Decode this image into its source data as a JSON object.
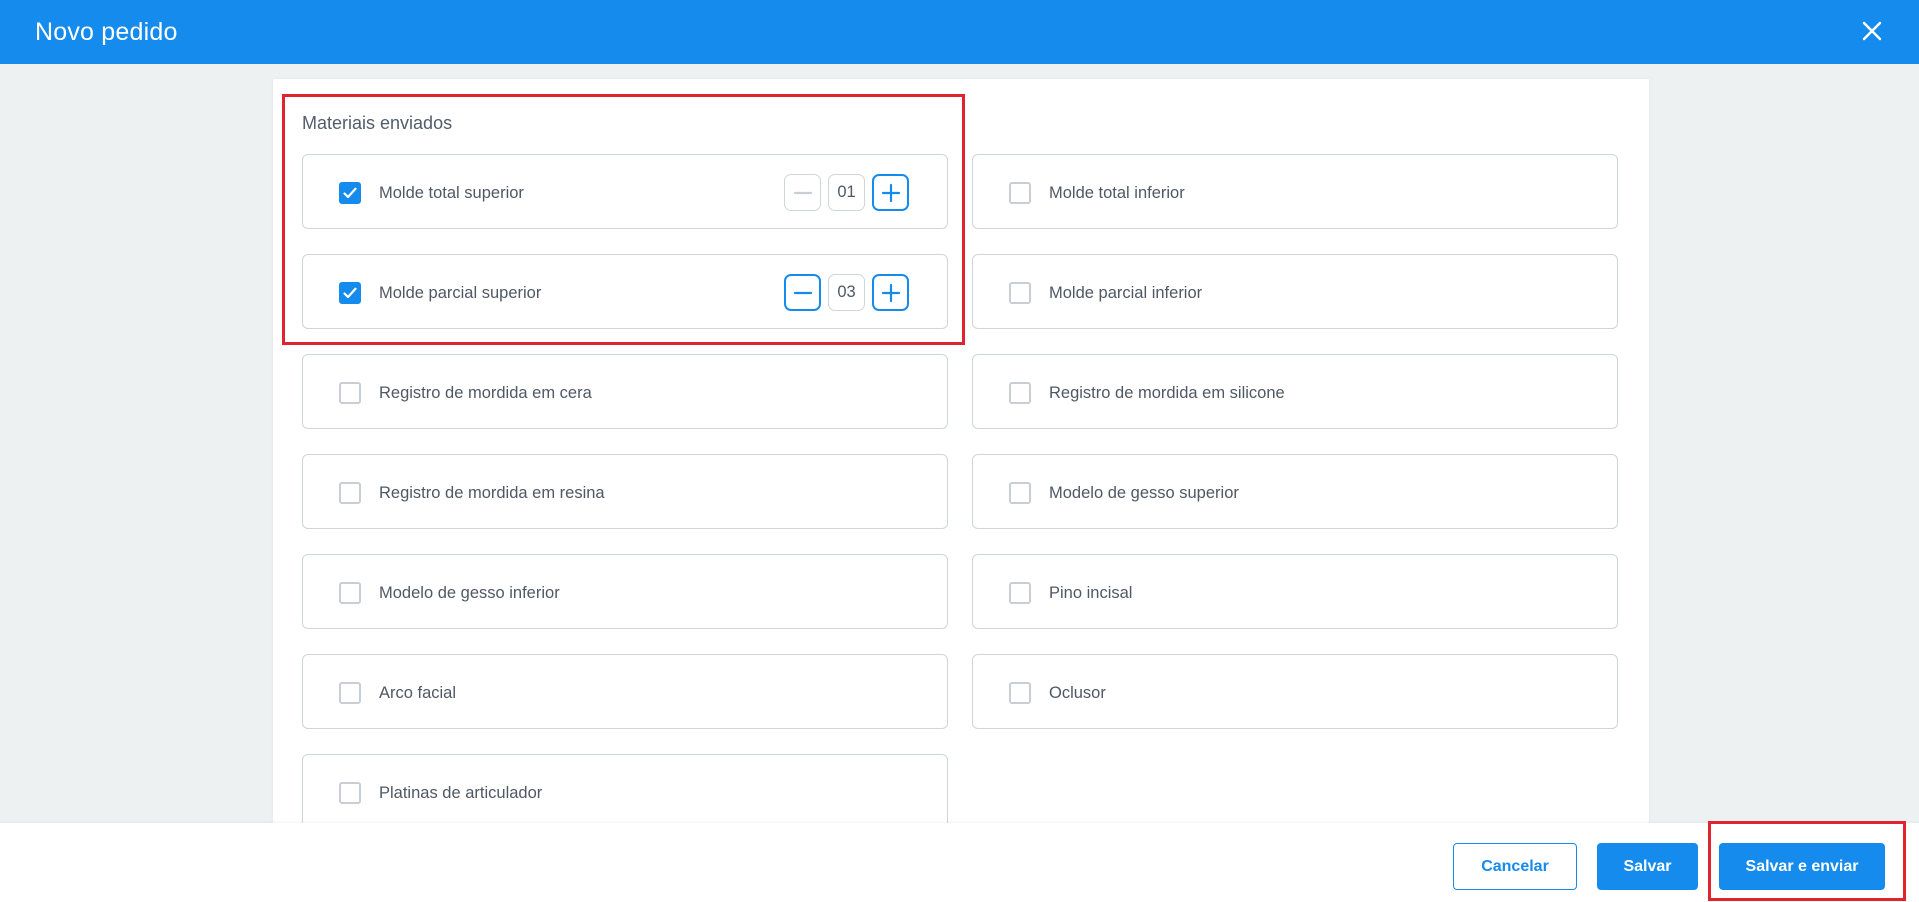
{
  "header": {
    "title": "Novo pedido",
    "close_icon": "close-icon"
  },
  "section": {
    "title": "Materiais enviados"
  },
  "materials": [
    {
      "label": "Molde total superior",
      "checked": true,
      "quantity": "01",
      "minus_disabled": true
    },
    {
      "label": "Molde total inferior",
      "checked": false
    },
    {
      "label": "Molde parcial superior",
      "checked": true,
      "quantity": "03",
      "minus_disabled": false
    },
    {
      "label": "Molde parcial inferior",
      "checked": false
    },
    {
      "label": "Registro de mordida em cera",
      "checked": false
    },
    {
      "label": "Registro de mordida em silicone",
      "checked": false
    },
    {
      "label": "Registro de mordida em resina",
      "checked": false
    },
    {
      "label": "Modelo de gesso superior",
      "checked": false
    },
    {
      "label": "Modelo de gesso inferior",
      "checked": false
    },
    {
      "label": "Pino incisal",
      "checked": false
    },
    {
      "label": "Arco facial",
      "checked": false
    },
    {
      "label": "Oclusor",
      "checked": false
    },
    {
      "label": "Platinas de articulador",
      "checked": false
    }
  ],
  "footer": {
    "cancel_label": "Cancelar",
    "save_label": "Salvar",
    "save_send_label": "Salvar e enviar"
  },
  "colors": {
    "primary": "#158ced",
    "highlight": "#e0232c"
  }
}
